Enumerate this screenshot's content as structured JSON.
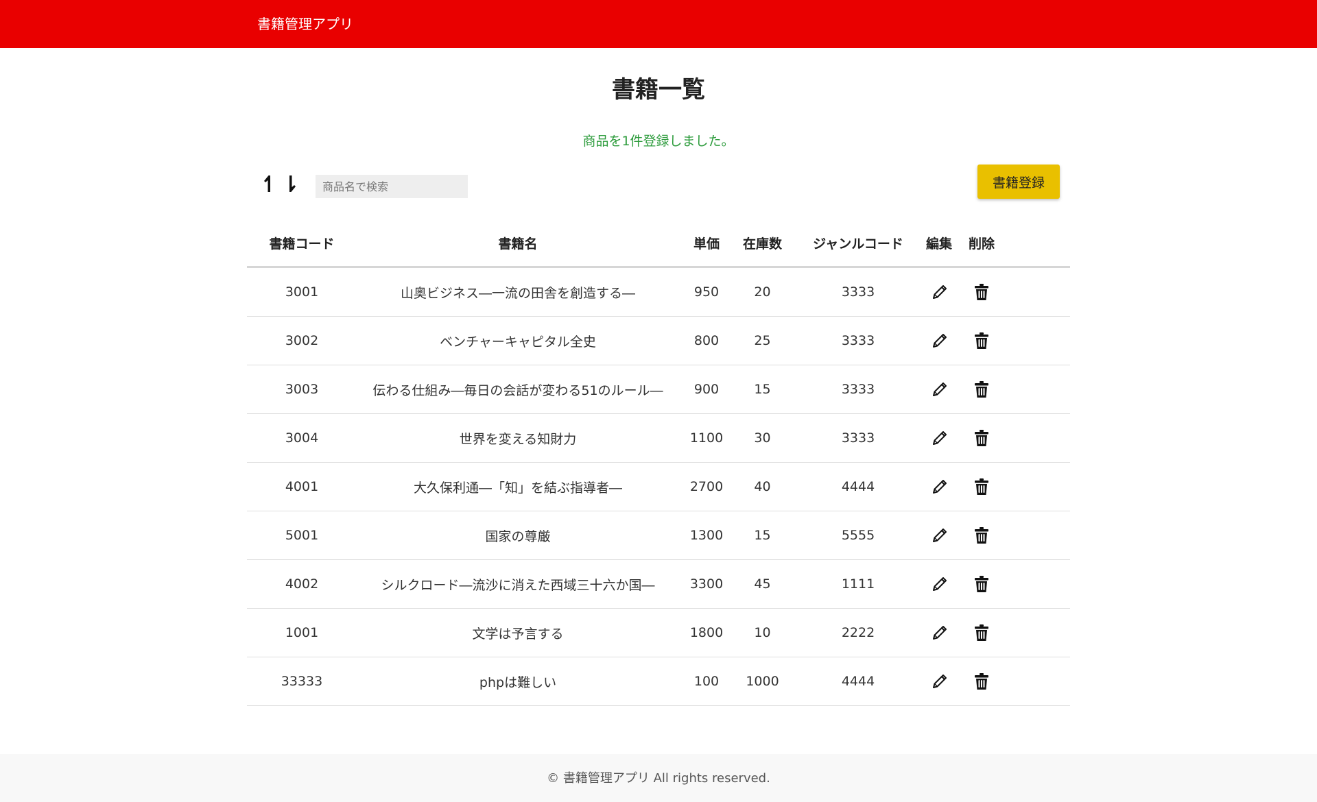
{
  "header": {
    "app_title": "書籍管理アプリ",
    "background_color": "#e90000"
  },
  "page": {
    "title": "書籍一覧",
    "flash_message": "商品を1件登録しました。",
    "flash_color": "#2e9c3d"
  },
  "toolbar": {
    "sort_asc_icon": "arrow-up-icon",
    "sort_desc_icon": "arrow-down-icon",
    "search_placeholder": "商品名で検索",
    "search_value": "",
    "register_label": "書籍登録",
    "register_color": "#e9c000"
  },
  "table": {
    "columns": {
      "code": "書籍コード",
      "name": "書籍名",
      "price": "単価",
      "stock": "在庫数",
      "genre": "ジャンルコード",
      "edit": "編集",
      "delete": "削除"
    },
    "edit_icon": "pencil-icon",
    "delete_icon": "trash-icon",
    "rows": [
      {
        "code": "3001",
        "name": "山奥ビジネス―一流の田舎を創造する―",
        "price": "950",
        "stock": "20",
        "genre": "3333"
      },
      {
        "code": "3002",
        "name": "ベンチャーキャピタル全史",
        "price": "800",
        "stock": "25",
        "genre": "3333"
      },
      {
        "code": "3003",
        "name": "伝わる仕組み―毎日の会話が変わる51のルール―",
        "price": "900",
        "stock": "15",
        "genre": "3333"
      },
      {
        "code": "3004",
        "name": "世界を変える知財力",
        "price": "1100",
        "stock": "30",
        "genre": "3333"
      },
      {
        "code": "4001",
        "name": "大久保利通―「知」を結ぶ指導者―",
        "price": "2700",
        "stock": "40",
        "genre": "4444"
      },
      {
        "code": "5001",
        "name": "国家の尊厳",
        "price": "1300",
        "stock": "15",
        "genre": "5555"
      },
      {
        "code": "4002",
        "name": "シルクロード―流沙に消えた西域三十六か国―",
        "price": "3300",
        "stock": "45",
        "genre": "1111"
      },
      {
        "code": "1001",
        "name": "文学は予言する",
        "price": "1800",
        "stock": "10",
        "genre": "2222"
      },
      {
        "code": "33333",
        "name": "phpは難しい",
        "price": "100",
        "stock": "1000",
        "genre": "4444"
      }
    ]
  },
  "footer": {
    "text": "© 書籍管理アプリ All rights reserved."
  }
}
